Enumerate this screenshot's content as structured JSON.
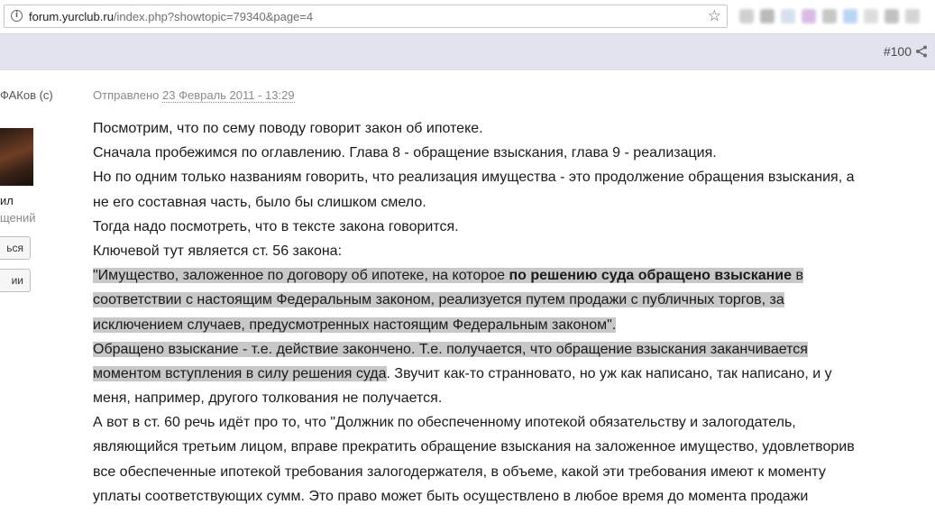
{
  "browser": {
    "url_host": "forum.yurclub.ru",
    "url_path": "/index.php?showtopic=79340&page=4",
    "info_icon": "info-icon",
    "bookmark_icon": "star-icon",
    "extensions": [
      {
        "name": "extension-icon",
        "color": "#bdbdbd"
      },
      {
        "name": "extension-icon",
        "color": "#9e9e9e"
      },
      {
        "name": "extension-icon",
        "color": "#c6d2e8"
      },
      {
        "name": "extension-icon",
        "color": "#c9a0dc"
      },
      {
        "name": "extension-icon",
        "color": "#b0b0b0"
      },
      {
        "name": "extension-icon",
        "color": "#9ec3f0"
      },
      {
        "name": "extension-icon",
        "color": "#d0d0d0"
      },
      {
        "name": "extension-icon",
        "color": "#a8a8a8"
      },
      {
        "name": "extension-icon",
        "color": "#c4c4c4"
      }
    ]
  },
  "post": {
    "number": "#100",
    "share_icon": "share-icon",
    "author": {
      "name": "ФАКов (с)",
      "group": "ил",
      "posts_label": "щений",
      "button_1": "ься",
      "button_2": "ии"
    },
    "meta": {
      "sent_label": "Отправлено",
      "date": "23 Февраль 2011 - 13:29"
    },
    "body": {
      "l1": "Посмотрим, что по сему поводу говорит закон об ипотеке.",
      "l2": "Сначала пробежимся по оглавлению. Глава 8 - обращение взыскания, глава 9 - реализация.",
      "l3": "Но по одним только названиям говорить, что реализация имущества - это продолжение обращения взыскания, а",
      "l4": "не его составная часть, было бы слишком смело.",
      "l5": "Тогда надо посмотреть, что в тексте закона говорится.",
      "l6": "Ключевой тут является ст. 56 закона:",
      "l7_pre": "\"Имущество, заложенное по договору об ипотеке, на которое ",
      "l7_bold": "по решению суда обращено взыскание",
      "l7_post": " в",
      "l8": "соответствии с настоящим Федеральным законом, реализуется путем продажи с публичных торгов, за",
      "l9": "исключением случаев, предусмотренных настоящим Федеральным законом\".",
      "l10": "Обращено взыскание - т.е. действие закончено. Т.е. получается, что обращение взыскания заканчивается",
      "l11_hl": "моментом вступления в силу решения суда",
      "l11_rest": ". Звучит как-то странновато, но уж как написано, так написано, и у",
      "l12": "меня, например, другого толкования не получается.",
      "l13": "А вот в ст. 60 речь идёт про то, что \"Должник по обеспеченному ипотекой обязательству и залогодатель,",
      "l14": "являющийся третьим лицом, вправе прекратить обращение взыскания на заложенное имущество, удовлетворив",
      "l15": "все обеспеченные ипотекой требования залогодержателя, в объеме, какой эти требования имеют к моменту",
      "l16": "уплаты соответствующих сумм. Это право может быть осуществлено в любое время до момента продажи"
    }
  },
  "colors": {
    "post_band": "#e1e3ee",
    "highlight": "#c8c8c8",
    "text": "#1a1a1a"
  }
}
